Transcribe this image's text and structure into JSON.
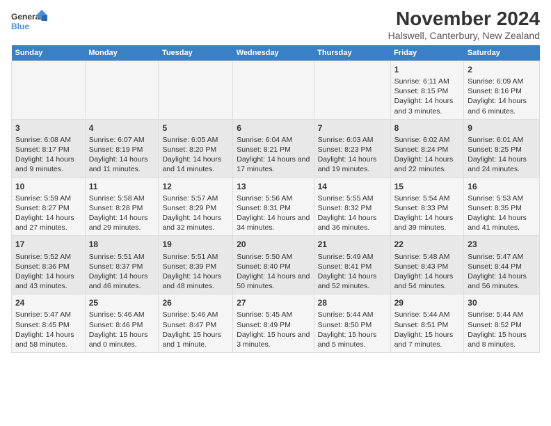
{
  "logo": {
    "line1": "General",
    "line2": "Blue"
  },
  "title": "November 2024",
  "subtitle": "Halswell, Canterbury, New Zealand",
  "days_of_week": [
    "Sunday",
    "Monday",
    "Tuesday",
    "Wednesday",
    "Thursday",
    "Friday",
    "Saturday"
  ],
  "weeks": [
    [
      {
        "day": "",
        "info": ""
      },
      {
        "day": "",
        "info": ""
      },
      {
        "day": "",
        "info": ""
      },
      {
        "day": "",
        "info": ""
      },
      {
        "day": "",
        "info": ""
      },
      {
        "day": "1",
        "info": "Sunrise: 6:11 AM\nSunset: 8:15 PM\nDaylight: 14 hours and 3 minutes."
      },
      {
        "day": "2",
        "info": "Sunrise: 6:09 AM\nSunset: 8:16 PM\nDaylight: 14 hours and 6 minutes."
      }
    ],
    [
      {
        "day": "3",
        "info": "Sunrise: 6:08 AM\nSunset: 8:17 PM\nDaylight: 14 hours and 9 minutes."
      },
      {
        "day": "4",
        "info": "Sunrise: 6:07 AM\nSunset: 8:19 PM\nDaylight: 14 hours and 11 minutes."
      },
      {
        "day": "5",
        "info": "Sunrise: 6:05 AM\nSunset: 8:20 PM\nDaylight: 14 hours and 14 minutes."
      },
      {
        "day": "6",
        "info": "Sunrise: 6:04 AM\nSunset: 8:21 PM\nDaylight: 14 hours and 17 minutes."
      },
      {
        "day": "7",
        "info": "Sunrise: 6:03 AM\nSunset: 8:23 PM\nDaylight: 14 hours and 19 minutes."
      },
      {
        "day": "8",
        "info": "Sunrise: 6:02 AM\nSunset: 8:24 PM\nDaylight: 14 hours and 22 minutes."
      },
      {
        "day": "9",
        "info": "Sunrise: 6:01 AM\nSunset: 8:25 PM\nDaylight: 14 hours and 24 minutes."
      }
    ],
    [
      {
        "day": "10",
        "info": "Sunrise: 5:59 AM\nSunset: 8:27 PM\nDaylight: 14 hours and 27 minutes."
      },
      {
        "day": "11",
        "info": "Sunrise: 5:58 AM\nSunset: 8:28 PM\nDaylight: 14 hours and 29 minutes."
      },
      {
        "day": "12",
        "info": "Sunrise: 5:57 AM\nSunset: 8:29 PM\nDaylight: 14 hours and 32 minutes."
      },
      {
        "day": "13",
        "info": "Sunrise: 5:56 AM\nSunset: 8:31 PM\nDaylight: 14 hours and 34 minutes."
      },
      {
        "day": "14",
        "info": "Sunrise: 5:55 AM\nSunset: 8:32 PM\nDaylight: 14 hours and 36 minutes."
      },
      {
        "day": "15",
        "info": "Sunrise: 5:54 AM\nSunset: 8:33 PM\nDaylight: 14 hours and 39 minutes."
      },
      {
        "day": "16",
        "info": "Sunrise: 5:53 AM\nSunset: 8:35 PM\nDaylight: 14 hours and 41 minutes."
      }
    ],
    [
      {
        "day": "17",
        "info": "Sunrise: 5:52 AM\nSunset: 8:36 PM\nDaylight: 14 hours and 43 minutes."
      },
      {
        "day": "18",
        "info": "Sunrise: 5:51 AM\nSunset: 8:37 PM\nDaylight: 14 hours and 46 minutes."
      },
      {
        "day": "19",
        "info": "Sunrise: 5:51 AM\nSunset: 8:39 PM\nDaylight: 14 hours and 48 minutes."
      },
      {
        "day": "20",
        "info": "Sunrise: 5:50 AM\nSunset: 8:40 PM\nDaylight: 14 hours and 50 minutes."
      },
      {
        "day": "21",
        "info": "Sunrise: 5:49 AM\nSunset: 8:41 PM\nDaylight: 14 hours and 52 minutes."
      },
      {
        "day": "22",
        "info": "Sunrise: 5:48 AM\nSunset: 8:43 PM\nDaylight: 14 hours and 54 minutes."
      },
      {
        "day": "23",
        "info": "Sunrise: 5:47 AM\nSunset: 8:44 PM\nDaylight: 14 hours and 56 minutes."
      }
    ],
    [
      {
        "day": "24",
        "info": "Sunrise: 5:47 AM\nSunset: 8:45 PM\nDaylight: 14 hours and 58 minutes."
      },
      {
        "day": "25",
        "info": "Sunrise: 5:46 AM\nSunset: 8:46 PM\nDaylight: 15 hours and 0 minutes."
      },
      {
        "day": "26",
        "info": "Sunrise: 5:46 AM\nSunset: 8:47 PM\nDaylight: 15 hours and 1 minute."
      },
      {
        "day": "27",
        "info": "Sunrise: 5:45 AM\nSunset: 8:49 PM\nDaylight: 15 hours and 3 minutes."
      },
      {
        "day": "28",
        "info": "Sunrise: 5:44 AM\nSunset: 8:50 PM\nDaylight: 15 hours and 5 minutes."
      },
      {
        "day": "29",
        "info": "Sunrise: 5:44 AM\nSunset: 8:51 PM\nDaylight: 15 hours and 7 minutes."
      },
      {
        "day": "30",
        "info": "Sunrise: 5:44 AM\nSunset: 8:52 PM\nDaylight: 15 hours and 8 minutes."
      }
    ]
  ]
}
